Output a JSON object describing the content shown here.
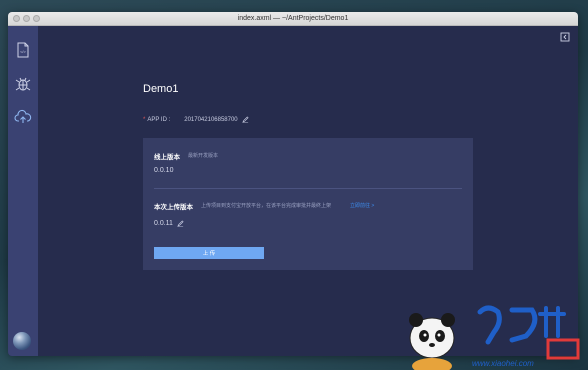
{
  "window": {
    "title": "index.axml — ~/AntProjects/Demo1"
  },
  "sidebar": {
    "items": [
      {
        "name": "file-icon"
      },
      {
        "name": "bug-icon"
      },
      {
        "name": "cloud-upload-icon"
      }
    ]
  },
  "app": {
    "name": "Demo1",
    "required_mark": "*",
    "appid_label": "APP ID :",
    "appid_value": "2017042106858700"
  },
  "online": {
    "title": "线上版本",
    "subtitle": "最新开发版本",
    "version": "0.0.10"
  },
  "upload": {
    "title": "本次上传版本",
    "desc": "上传项目到支付宝开放平台，在该平台完成审批并最终上架",
    "link": "立即前往 >",
    "version": "0.0.11",
    "button": "上 传"
  },
  "colors": {
    "accent": "#6fa8f2",
    "sidebar": "#3a4272",
    "background": "#262c4d"
  }
}
